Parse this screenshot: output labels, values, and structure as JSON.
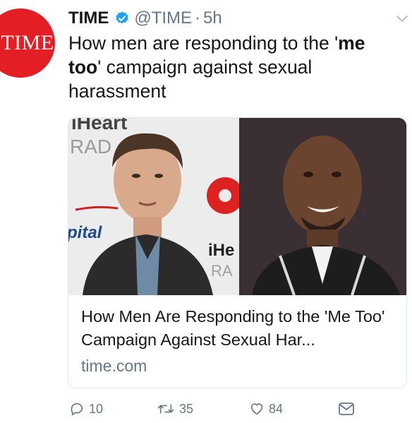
{
  "author": {
    "avatar_text": "TIME",
    "name": "TIME",
    "handle": "@TIME",
    "separator": "·",
    "time": "5h"
  },
  "tweet": {
    "text_before": "How men are responding to the '",
    "text_bold": "me too",
    "text_after": "' campaign against sexual harassment"
  },
  "card": {
    "image_left_sign_text": "iHeart",
    "image_left_sign_text2": "RAD",
    "image_left_sign_text3": "pital",
    "image_right_sign_text": "iHe",
    "image_right_sign_text2": "RA",
    "title": "How Men Are Responding to the 'Me Too' Campaign Against Sexual Har...",
    "domain": "time.com"
  },
  "actions": {
    "reply_count": "10",
    "retweet_count": "35",
    "like_count": "84"
  },
  "colors": {
    "brand_red": "#e31e24",
    "verified_blue": "#1da1f2",
    "secondary_text": "#657786"
  }
}
